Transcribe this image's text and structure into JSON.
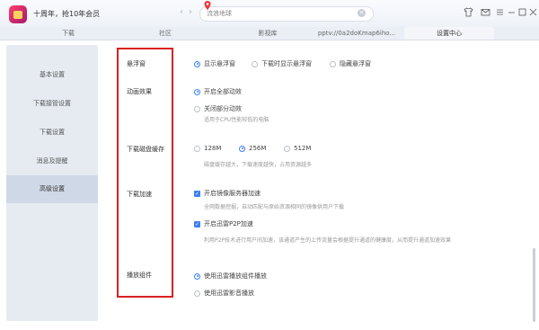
{
  "titlebar": {
    "promo_text": "十周年，抢10年会员",
    "back_icon": "chevron-left-icon",
    "forward_icon": "chevron-right-icon",
    "search_placeholder": "流浪地球",
    "window_icons": [
      "tshirt-icon",
      "mail-icon",
      "menu-icon",
      "minimize-icon",
      "maximize-icon",
      "close-icon"
    ]
  },
  "tabs": [
    {
      "label": "下载"
    },
    {
      "label": "社区"
    },
    {
      "label": "影视库"
    },
    {
      "label": "pptv://0a2doKmap6iho..."
    },
    {
      "label": "设置中心"
    }
  ],
  "sidebar": {
    "items": [
      {
        "label": "基本设置"
      },
      {
        "label": "下载接管设置"
      },
      {
        "label": "下载设置"
      },
      {
        "label": "消息及提醒"
      },
      {
        "label": "高级设置"
      }
    ]
  },
  "settings": {
    "float": {
      "label": "悬浮窗",
      "options": [
        "显示悬浮窗",
        "下载时显示悬浮窗",
        "隐藏悬浮窗"
      ]
    },
    "animation": {
      "label": "动画效果",
      "opt_all": "开启全部动效",
      "opt_partial": "关闭部分动效",
      "desc": "适用于CPU性能较低的电脑"
    },
    "cache": {
      "label": "下载磁盘缓存",
      "options": [
        "128M",
        "256M",
        "512M"
      ],
      "desc": "磁盘缓存越大，下载速度越快，占用资源越多"
    },
    "accel": {
      "label": "下载加速",
      "opt_mirror": "开启镜像服务器加速",
      "desc_mirror": "全网数据挖掘，自动匹配与原始资源相同的镜像供用户下载",
      "opt_p2p": "开启迅雷P2P加速",
      "desc_p2p": "利用P2P技术进行用户间加速，该通道产生的上传流量会根据提升通道的健康度，从而提升通道加速效果"
    },
    "player": {
      "label": "播放组件",
      "opt_xunlei": "使用迅雷播放组件播放",
      "opt_yingyin": "使用迅雷影音播放"
    }
  },
  "colors": {
    "accent": "#3b7ff2",
    "highlight_box": "#d92121"
  }
}
